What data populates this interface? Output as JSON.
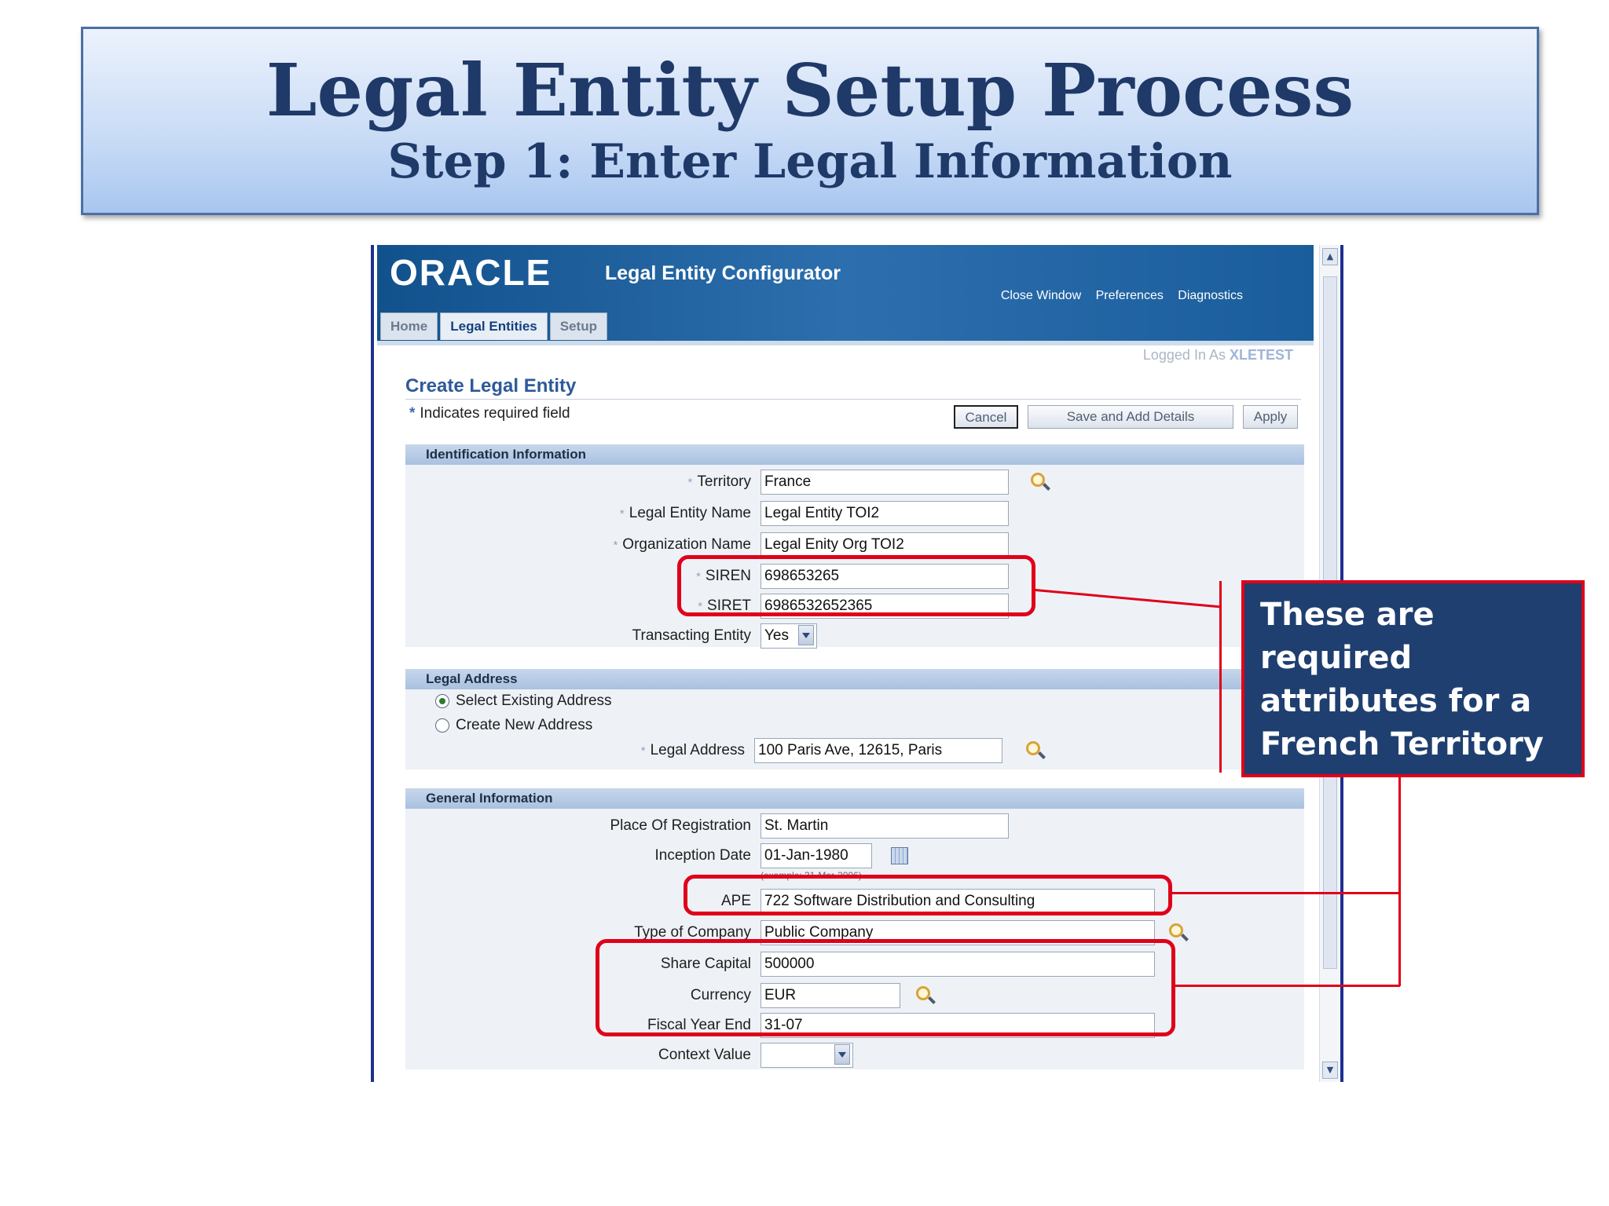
{
  "banner": {
    "title": "Legal Entity Setup Process",
    "subtitle": "Step 1: Enter Legal Information"
  },
  "app": {
    "logo": "ORACLE",
    "name": "Legal Entity Configurator",
    "global_links": [
      "Close Window",
      "Preferences",
      "Diagnostics"
    ],
    "tabs": [
      "Home",
      "Legal Entities",
      "Setup"
    ],
    "active_tab": "Legal Entities",
    "logged_in_label": "Logged In As",
    "logged_in_user": "XLETEST"
  },
  "page": {
    "heading": "Create Legal Entity",
    "required_note": "Indicates required field",
    "buttons": {
      "cancel": "Cancel",
      "save_add": "Save and Add Details",
      "apply": "Apply"
    }
  },
  "identification": {
    "title": "Identification Information",
    "territory_label": "Territory",
    "territory": "France",
    "le_name_label": "Legal Entity Name",
    "le_name": "Legal Entity TOI2",
    "org_name_label": "Organization Name",
    "org_name": "Legal Enity Org TOI2",
    "siren_label": "SIREN",
    "siren": "698653265",
    "siret_label": "SIRET",
    "siret": "6986532652365",
    "transacting_label": "Transacting Entity",
    "transacting": "Yes"
  },
  "legal_address": {
    "title": "Legal Address",
    "option_existing": "Select Existing Address",
    "option_new": "Create New Address",
    "address_label": "Legal Address",
    "address": "100 Paris Ave, 12615, Paris"
  },
  "general": {
    "title": "General Information",
    "place_label": "Place Of Registration",
    "place": "St. Martin",
    "inception_label": "Inception Date",
    "inception": "01-Jan-1980",
    "inception_hint": "(example: 31-Mar-2006)",
    "ape_label": "APE",
    "ape": "722 Software Distribution and Consulting",
    "type_label": "Type of Company",
    "type": "Public Company",
    "capital_label": "Share Capital",
    "capital": "500000",
    "currency_label": "Currency",
    "currency": "EUR",
    "fiscal_label": "Fiscal Year End",
    "fiscal": "31-07",
    "context_label": "Context Value",
    "context": ""
  },
  "callout": {
    "text": "These are required attributes for a French Territory"
  },
  "colors": {
    "accent_red": "#e0001a",
    "callout_bg": "#1f3f70",
    "header_blue": "#1a5d9c"
  }
}
